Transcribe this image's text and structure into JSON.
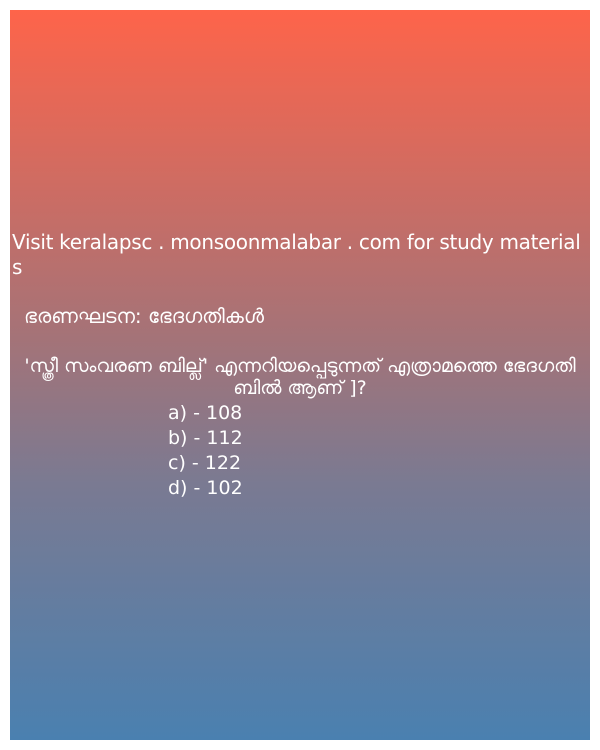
{
  "visit_text": "Visit keralapsc . monsoonmalabar . com for study materials",
  "topic": "ഭരണഘടന: ഭേദഗതികൾ",
  "question": "'സ്ത്രീ സംവരണ ബില്ല്' എന്നറിയപ്പെടുന്നത് എത്രാമത്തെ ഭേദഗതി ബിൽ ആണ് ]?",
  "options": [
    {
      "label": "a) - 108"
    },
    {
      "label": "b) - 112"
    },
    {
      "label": "c) - 122"
    },
    {
      "label": "d) - 102"
    }
  ]
}
